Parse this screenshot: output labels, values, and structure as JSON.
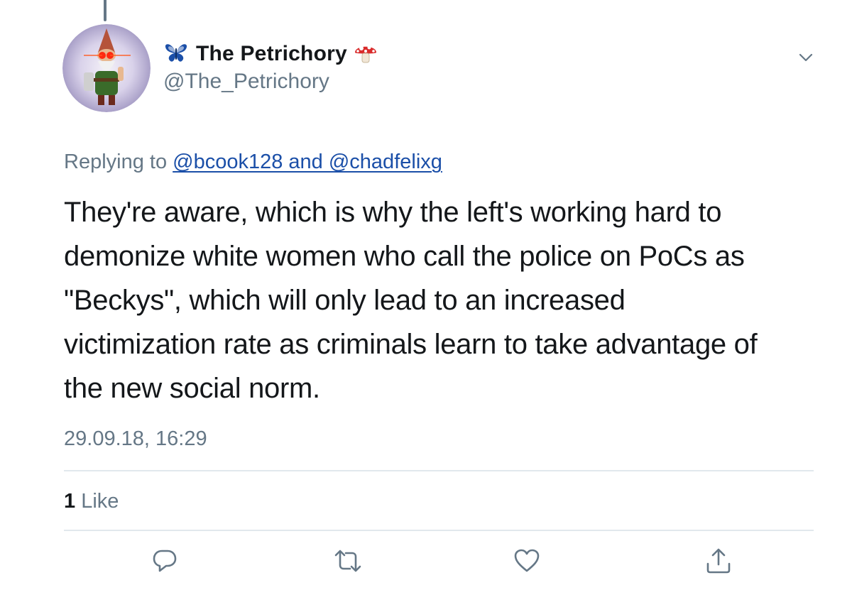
{
  "tweet": {
    "author": {
      "display_name": "The Petrichory",
      "handle": "@The_Petrichory",
      "avatar_icon": "gnome-avatar",
      "name_prefix_icon": "butterfly-icon",
      "name_suffix_icon": "mushroom-icon"
    },
    "reply": {
      "prefix": "Replying to ",
      "mentions": "@bcook128 and @chadfelixg"
    },
    "text_lines": [
      "They're aware, which is why the left's working hard to",
      "demonize white women who call the police on PoCs as",
      "\"Beckys\", which will only lead to an increased",
      "victimization rate as criminals learn to take advantage of",
      "the new social norm."
    ],
    "timestamp": "29.09.18, 16:29",
    "stats": {
      "likes_count": "1",
      "likes_label": " Like"
    },
    "actions": [
      "reply-icon",
      "retweet-icon",
      "like-icon",
      "share-icon"
    ]
  },
  "colors": {
    "text_primary": "#14171a",
    "text_secondary": "#657786",
    "link": "#1b4fa8",
    "divider": "#e1e8ed",
    "butterfly": "#1b4fa8",
    "mushroom": "#d92b2b"
  }
}
